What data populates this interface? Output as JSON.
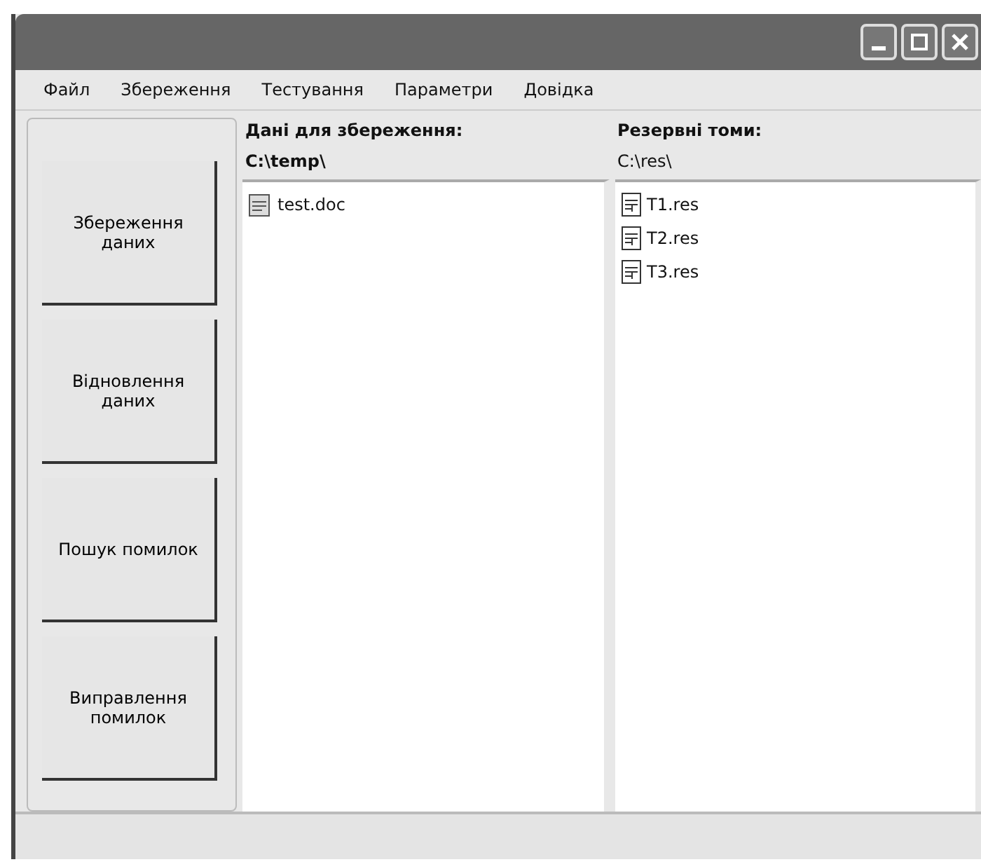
{
  "menu": [
    "Файл",
    "Збереження",
    "Тестування",
    "Параметри",
    "Довідка"
  ],
  "actions": [
    "Збереження даних",
    "Відновлення даних",
    "Пошук помилок",
    "Виправлення помилок"
  ],
  "panes": [
    {
      "heading": "Дані для збереження:",
      "path": "C:\\temp\\",
      "files": [
        {
          "name": "test.doc",
          "kind": "doc"
        }
      ]
    },
    {
      "heading": "Резервні томи:",
      "path": "C:\\res\\",
      "files": [
        {
          "name": "T1.res",
          "kind": "res"
        },
        {
          "name": "T2.res",
          "kind": "res"
        },
        {
          "name": "T3.res",
          "kind": "res"
        }
      ]
    }
  ]
}
